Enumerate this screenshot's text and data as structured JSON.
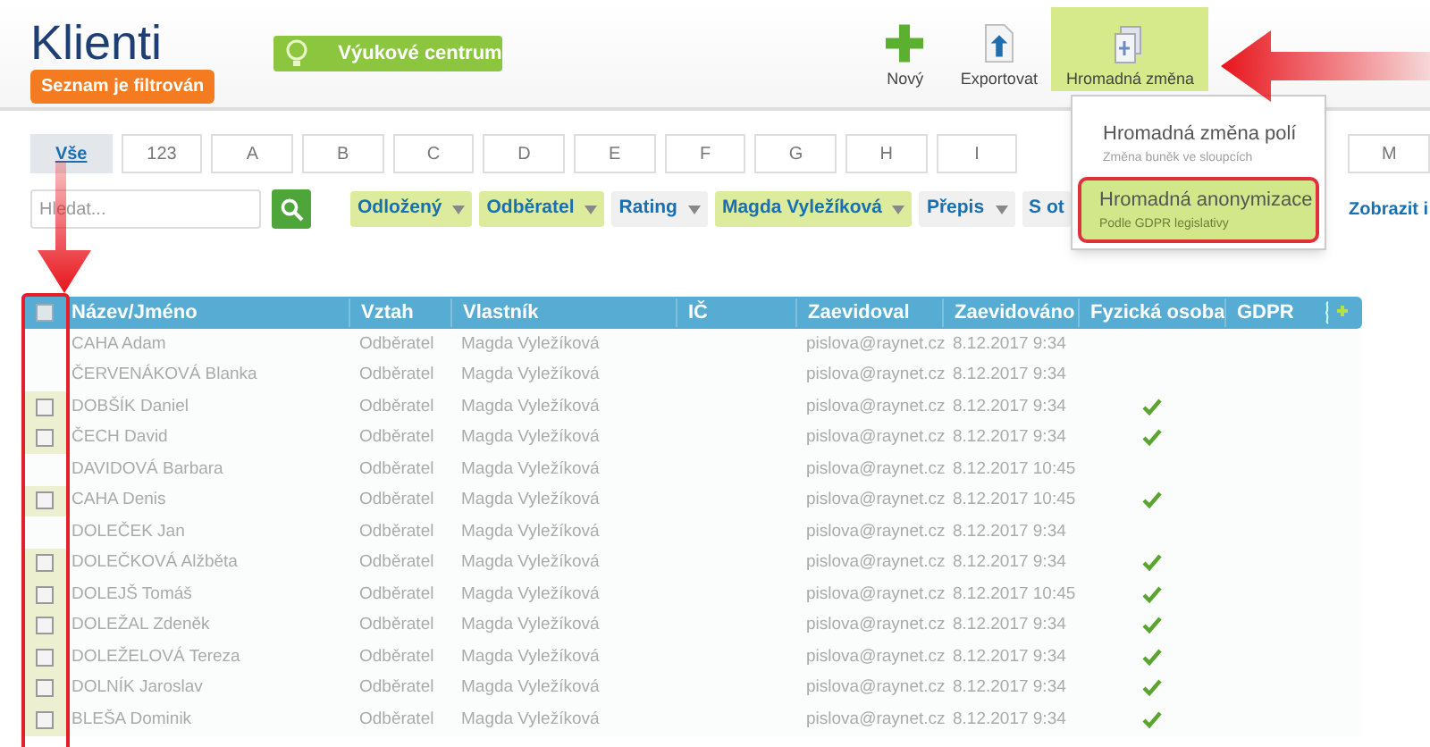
{
  "header": {
    "title": "Klienti",
    "filter_badge": "Seznam je filtrován",
    "learning_button": "Výukové centrum"
  },
  "toolbar": [
    {
      "label": "Nový",
      "kind": "new",
      "active": false
    },
    {
      "label": "Exportovat",
      "kind": "export",
      "active": false
    },
    {
      "label": "Hromadná změna",
      "kind": "bulk",
      "active": true
    }
  ],
  "bulk_menu": [
    {
      "title": "Hromadná změna polí",
      "subtitle": "Změna buněk ve sloupcích",
      "selected": false
    },
    {
      "title": "Hromadná anonymizace",
      "subtitle": "Podle GDPR legislativy",
      "selected": true
    }
  ],
  "letter_tabs": [
    {
      "label": "Vše",
      "selected": true
    },
    {
      "label": "123",
      "selected": false
    },
    {
      "label": "A",
      "selected": false
    },
    {
      "label": "B",
      "selected": false
    },
    {
      "label": "C",
      "selected": false
    },
    {
      "label": "D",
      "selected": false
    },
    {
      "label": "E",
      "selected": false
    },
    {
      "label": "F",
      "selected": false
    },
    {
      "label": "G",
      "selected": false
    },
    {
      "label": "H",
      "selected": false
    },
    {
      "label": "I",
      "selected": false
    }
  ],
  "letter_tabs_after_menu": [
    {
      "label": "M",
      "selected": false
    }
  ],
  "search": {
    "placeholder": "Hledat..."
  },
  "filters": [
    {
      "label": "Odložený",
      "kind": "dropdown",
      "active": true
    },
    {
      "label": "Odběratel",
      "kind": "dropdown",
      "active": true
    },
    {
      "label": "Rating",
      "kind": "dropdown",
      "active": false
    },
    {
      "label": "Magda Vyležíková",
      "kind": "dropdown",
      "active": true
    },
    {
      "label": "Přepis",
      "kind": "dropdown",
      "active": false
    },
    {
      "label": "S ot",
      "kind": "plain",
      "active": false
    }
  ],
  "show_link": "Zobrazit i",
  "table": {
    "all_selected": false,
    "columns": [
      "Název/Jméno",
      "Vztah",
      "Vlastník",
      "IČ",
      "Zaevidoval",
      "Zaevidováno",
      "Fyzická osoba",
      "GDPR"
    ],
    "rows": [
      {
        "name": "CAHA Adam",
        "relation": "Odběratel",
        "owner": "Magda Vyležíková",
        "created_by": "pislova@raynet.cz",
        "created_at": "8.12.2017 9:34",
        "natural_person": false,
        "selectable": false
      },
      {
        "name": "ČERVENÁKOVÁ Blanka",
        "relation": "Odběratel",
        "owner": "Magda Vyležíková",
        "created_by": "pislova@raynet.cz",
        "created_at": "8.12.2017 9:34",
        "natural_person": false,
        "selectable": false
      },
      {
        "name": "DOBŠÍK Daniel",
        "relation": "Odběratel",
        "owner": "Magda Vyležíková",
        "created_by": "pislova@raynet.cz",
        "created_at": "8.12.2017 9:34",
        "natural_person": true,
        "selectable": true
      },
      {
        "name": "ČECH David",
        "relation": "Odběratel",
        "owner": "Magda Vyležíková",
        "created_by": "pislova@raynet.cz",
        "created_at": "8.12.2017 9:34",
        "natural_person": true,
        "selectable": true
      },
      {
        "name": "DAVIDOVÁ Barbara",
        "relation": "Odběratel",
        "owner": "Magda Vyležíková",
        "created_by": "pislova@raynet.cz",
        "created_at": "8.12.2017 10:45",
        "natural_person": false,
        "selectable": false
      },
      {
        "name": "CAHA Denis",
        "relation": "Odběratel",
        "owner": "Magda Vyležíková",
        "created_by": "pislova@raynet.cz",
        "created_at": "8.12.2017 10:45",
        "natural_person": true,
        "selectable": true
      },
      {
        "name": "DOLEČEK Jan",
        "relation": "Odběratel",
        "owner": "Magda Vyležíková",
        "created_by": "pislova@raynet.cz",
        "created_at": "8.12.2017 9:34",
        "natural_person": false,
        "selectable": false
      },
      {
        "name": "DOLEČKOVÁ Alžběta",
        "relation": "Odběratel",
        "owner": "Magda Vyležíková",
        "created_by": "pislova@raynet.cz",
        "created_at": "8.12.2017 9:34",
        "natural_person": true,
        "selectable": true
      },
      {
        "name": "DOLEJŠ Tomáš",
        "relation": "Odběratel",
        "owner": "Magda Vyležíková",
        "created_by": "pislova@raynet.cz",
        "created_at": "8.12.2017 10:45",
        "natural_person": true,
        "selectable": true
      },
      {
        "name": "DOLEŽAL Zdeněk",
        "relation": "Odběratel",
        "owner": "Magda Vyležíková",
        "created_by": "pislova@raynet.cz",
        "created_at": "8.12.2017 9:34",
        "natural_person": true,
        "selectable": true
      },
      {
        "name": "DOLEŽELOVÁ Tereza",
        "relation": "Odběratel",
        "owner": "Magda Vyležíková",
        "created_by": "pislova@raynet.cz",
        "created_at": "8.12.2017 9:34",
        "natural_person": true,
        "selectable": true
      },
      {
        "name": "DOLNÍK Jaroslav",
        "relation": "Odběratel",
        "owner": "Magda Vyležíková",
        "created_by": "pislova@raynet.cz",
        "created_at": "8.12.2017 9:34",
        "natural_person": true,
        "selectable": true
      },
      {
        "name": "BLEŠA Dominik",
        "relation": "Odběratel",
        "owner": "Magda Vyležíková",
        "created_by": "pislova@raynet.cz",
        "created_at": "8.12.2017 9:34",
        "natural_person": true,
        "selectable": true
      }
    ]
  }
}
